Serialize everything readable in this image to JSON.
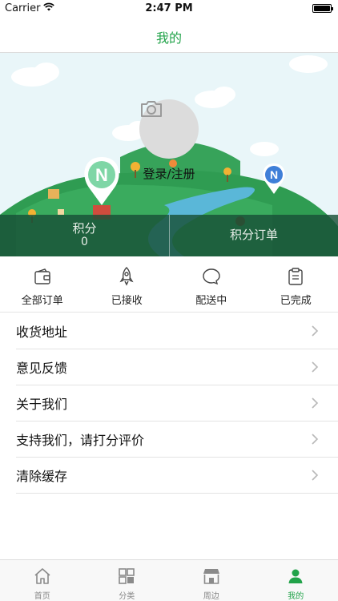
{
  "status_bar": {
    "carrier": "Carrier",
    "time": "2:47 PM"
  },
  "nav": {
    "title": "我的"
  },
  "hero": {
    "login_label": "登录/注册",
    "pin_left_letter": "N",
    "pin_right_letter": "N",
    "points_label": "积分",
    "points_value": "0",
    "points_orders_label": "积分订单"
  },
  "orders": [
    {
      "label": "全部订单",
      "icon": "wallet-icon"
    },
    {
      "label": "已接收",
      "icon": "rocket-icon"
    },
    {
      "label": "配送中",
      "icon": "chat-bubble-icon"
    },
    {
      "label": "已完成",
      "icon": "clipboard-icon"
    }
  ],
  "menu": [
    {
      "label": "收货地址"
    },
    {
      "label": "意见反馈"
    },
    {
      "label": "关于我们"
    },
    {
      "label": "支持我们，请打分评价"
    },
    {
      "label": "清除缓存"
    }
  ],
  "tabs": [
    {
      "label": "首页",
      "icon": "home-icon",
      "active": false
    },
    {
      "label": "分类",
      "icon": "grid-icon",
      "active": false
    },
    {
      "label": "周边",
      "icon": "shop-icon",
      "active": false
    },
    {
      "label": "我的",
      "icon": "person-icon",
      "active": true
    }
  ],
  "colors": {
    "accent": "#22a34a",
    "hill": "#3aa35d",
    "sky": "#e9f6f9"
  }
}
